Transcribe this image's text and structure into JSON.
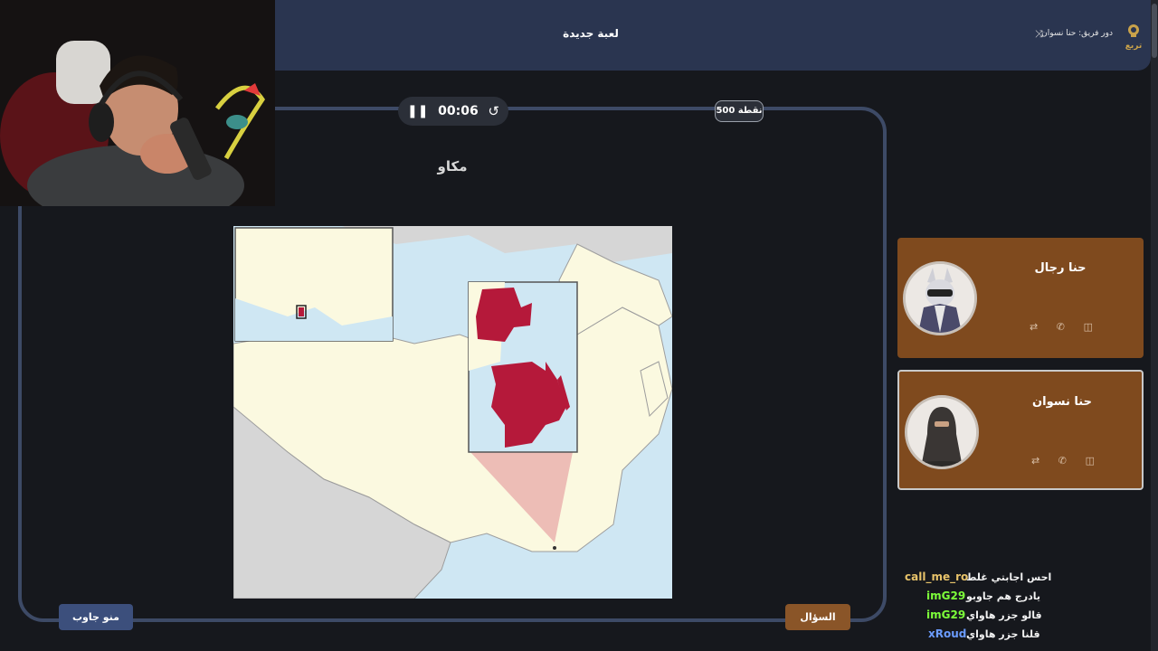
{
  "topbar": {
    "new_game": "لعبة جديدة",
    "team_turn": "دور فريق: حنا نسوان",
    "logo_text": "تربع"
  },
  "timer": {
    "time": "00:06"
  },
  "points": "500 نقطة",
  "question": {
    "title": "مكاو"
  },
  "buttons": {
    "who_answered": "منو جاوب",
    "question": "السؤال"
  },
  "teams": [
    {
      "name": "حنا رجال"
    },
    {
      "name": "حنا نسوان"
    }
  ],
  "chat": [
    {
      "user": "call_me_ro",
      "message": "احس اجابتي غلط",
      "color": "#e8c36a"
    },
    {
      "user": "imG29",
      "message": "يادرج هم جاوبو",
      "color": "#7dff3a"
    },
    {
      "user": "imG29",
      "message": "قالو جزر هاواي",
      "color": "#7dff3a"
    },
    {
      "user": "xRoud",
      "message": "قلنا جزر هاواي",
      "color": "#6b9cff"
    }
  ],
  "colors": {
    "topbar": "#2a3550",
    "frame": "#3d4a66",
    "team_card": "#7f4a1e",
    "macau_highlight": "#b5193a"
  }
}
